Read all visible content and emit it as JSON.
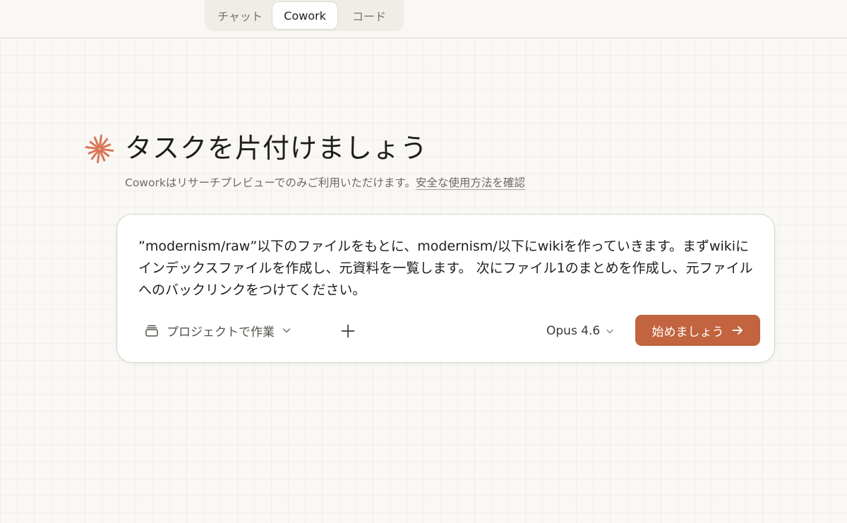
{
  "modes": {
    "chat": "チャット",
    "cowork": "Cowork",
    "code": "コード",
    "active": "cowork"
  },
  "hero": {
    "icon": "sparkle-asterisk-icon",
    "icon_color": "#d97757",
    "title": "タスクを片付けましょう",
    "subtitle": "Coworkはリサーチプレビューでのみご利用いただけます。",
    "safety_link": "安全な使用方法を確認"
  },
  "composer": {
    "prompt": "”modernism/raw”以下のファイルをもとに、modernism/以下にwikiを作っていきます。まずwikiにインデックスファイルを作成し、元資料を一覧します。 次にファイル1のまとめを作成し、元ファイルへのバックリンクをつけてください。",
    "project_label": "プロジェクトで作業",
    "model": "Opus 4.6",
    "start_label": "始めましょう",
    "accent_color": "#c2643f"
  }
}
